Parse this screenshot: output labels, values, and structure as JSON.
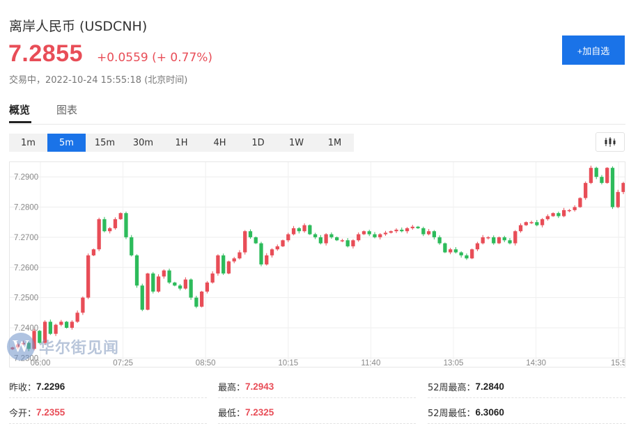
{
  "header": {
    "title": "离岸人民币 (USDCNH)",
    "price": "7.2855",
    "change": "+0.0559 (+ 0.77%)",
    "status": "交易中，2022-10-24 15:55:18 (北京时间)",
    "add_button": "+加自选"
  },
  "tabs": [
    {
      "label": "概览",
      "active": true
    },
    {
      "label": "图表",
      "active": false
    }
  ],
  "periods": [
    {
      "label": "1m",
      "active": false
    },
    {
      "label": "5m",
      "active": true
    },
    {
      "label": "15m",
      "active": false
    },
    {
      "label": "30m",
      "active": false
    },
    {
      "label": "1H",
      "active": false
    },
    {
      "label": "4H",
      "active": false
    },
    {
      "label": "1D",
      "active": false
    },
    {
      "label": "1W",
      "active": false
    },
    {
      "label": "1M",
      "active": false
    }
  ],
  "chart_type_icon": "candlestick-icon",
  "watermark": {
    "logo_letter": "W",
    "text": "华尔街见闻"
  },
  "colors": {
    "up": "#e84d57",
    "down": "#2dbb5b",
    "accent": "#1a73e8"
  },
  "chart_data": {
    "type": "candlestick",
    "x_ticks": [
      "06:00",
      "07:25",
      "08:50",
      "10:15",
      "11:40",
      "13:05",
      "14:30",
      "15:5"
    ],
    "y_ticks": [
      "7.2900",
      "7.2800",
      "7.2700",
      "7.2600",
      "7.2500",
      "7.2400",
      "7.2300"
    ],
    "ylim": [
      7.228,
      7.2935
    ],
    "grid": true,
    "close": [
      7.2335,
      7.2345,
      7.235,
      7.233,
      7.239,
      7.235,
      7.242,
      7.238,
      7.241,
      7.242,
      7.24,
      7.242,
      7.245,
      7.25,
      7.264,
      7.266,
      7.276,
      7.272,
      7.273,
      7.276,
      7.278,
      7.27,
      7.264,
      7.254,
      7.246,
      7.258,
      7.252,
      7.257,
      7.259,
      7.255,
      7.254,
      7.253,
      7.256,
      7.25,
      7.247,
      7.252,
      7.255,
      7.258,
      7.264,
      7.258,
      7.262,
      7.263,
      7.265,
      7.272,
      7.27,
      7.268,
      7.261,
      7.264,
      7.266,
      7.267,
      7.269,
      7.271,
      7.273,
      7.272,
      7.274,
      7.271,
      7.27,
      7.268,
      7.271,
      7.27,
      7.269,
      7.269,
      7.267,
      7.269,
      7.271,
      7.272,
      7.271,
      7.27,
      7.271,
      7.2715,
      7.272,
      7.2725,
      7.272,
      7.273,
      7.2735,
      7.273,
      7.271,
      7.272,
      7.27,
      7.268,
      7.265,
      7.266,
      7.265,
      7.264,
      7.263,
      7.266,
      7.268,
      7.27,
      7.27,
      7.268,
      7.27,
      7.269,
      7.268,
      7.272,
      7.274,
      7.275,
      7.275,
      7.274,
      7.276,
      7.277,
      7.278,
      7.277,
      7.279,
      7.279,
      7.28,
      7.283,
      7.288,
      7.293,
      7.29,
      7.288,
      7.293,
      7.28,
      7.285,
      7.288
    ]
  },
  "stats": [
    {
      "label": "昨收：",
      "value": "7.2296",
      "color": "black"
    },
    {
      "label": "最高：",
      "value": "7.2943",
      "color": "red"
    },
    {
      "label": "52周最高：",
      "value": "7.2840",
      "color": "black"
    },
    {
      "label": "今开：",
      "value": "7.2355",
      "color": "red"
    },
    {
      "label": "最低：",
      "value": "7.2325",
      "color": "red"
    },
    {
      "label": "52周最低：",
      "value": "6.3060",
      "color": "black"
    }
  ]
}
